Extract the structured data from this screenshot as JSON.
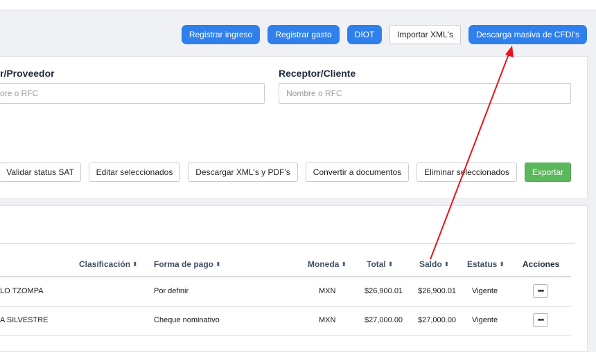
{
  "toolbar": {
    "registrar_ingreso": "Registrar ingreso",
    "registrar_gasto": "Registrar gasto",
    "diot": "DIOT",
    "importar_xml": "Importar XML's",
    "descarga_masiva": "Descarga masiva de CFDI's"
  },
  "filters": {
    "emisor_label": "r/Proveedor",
    "emisor_placeholder": "ore o RFC",
    "receptor_label": "Receptor/Cliente",
    "receptor_placeholder": "Nombre o RFC"
  },
  "actions": {
    "validar": "Validar status SAT",
    "editar": "Editar seleccionados",
    "descargar": "Descargar XML's y PDF's",
    "convertir": "Convertir a documentos",
    "eliminar": "Eliminar seleccionados",
    "exportar": "Exportar"
  },
  "table": {
    "sort_glyph": "⬍",
    "headers": {
      "clasificacion": "Clasificación",
      "forma_pago": "Forma de pago",
      "moneda": "Moneda",
      "total": "Total",
      "saldo": "Saldo",
      "estatus": "Estatus",
      "acciones": "Acciones"
    },
    "rows": [
      {
        "nombre": "LO TZOMPA",
        "forma_pago": "Por definir",
        "moneda": "MXN",
        "total": "$26,900.01",
        "saldo": "$26,900.01",
        "estatus": "Vigente",
        "acciones": "•••"
      },
      {
        "nombre": "A SILVESTRE",
        "forma_pago": "Cheque nominativo",
        "moneda": "MXN",
        "total": "$27,000.00",
        "saldo": "$27,000.00",
        "estatus": "Vigente",
        "acciones": "•••"
      }
    ]
  },
  "colors": {
    "primary": "#2f80ec",
    "success": "#5cb85c",
    "annotation_arrow": "#e8141b"
  }
}
